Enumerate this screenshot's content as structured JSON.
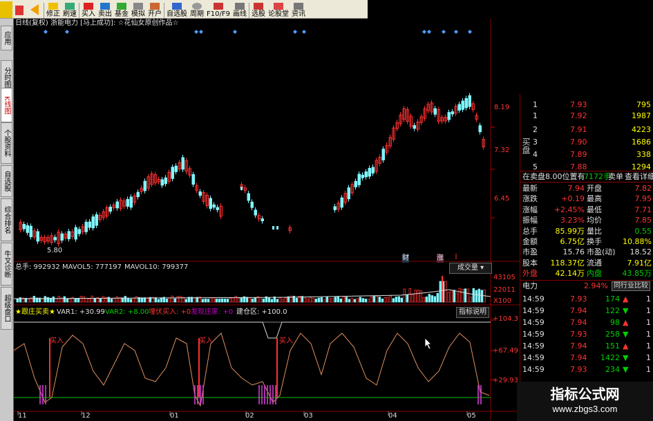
{
  "toolbar": {
    "items": [
      "修正",
      "刷速",
      "买入",
      "卖出",
      "基金",
      "模拟",
      "开户",
      "自选股",
      "周期",
      "F10/F9",
      "画线",
      "选股",
      "论股堂",
      "资讯"
    ]
  },
  "sidetabs": [
    "应用",
    "分时图",
    "K线图",
    "个股资料",
    "自选股",
    "综合排名",
    "牛叉诊断",
    "超级盘口"
  ],
  "chart": {
    "title": "日线(复权)  浙能电力 [马上成功]: ☆花仙女原创作品☆",
    "price_labels": [
      "8.19",
      "7.32",
      "6.45"
    ],
    "low_label": "5.80",
    "marks": [
      "财",
      "涨"
    ],
    "volume_header": {
      "total": "总手: 992932",
      "ma5": "MAVOL5: 777197",
      "ma10": "MAVOL10: 799377"
    },
    "volume_button": "成交量",
    "volume_labels": [
      "43105",
      "22011",
      "X100"
    ],
    "indicator_header": {
      "name": "★跟庄买卖★",
      "var1": "VAR1: +30.99",
      "var2": "VAR2: +8.00",
      "ambush": "埋伏买入: +0",
      "discover": "发现庄家: +0",
      "build": "建仓区: +100.0"
    },
    "indicator_button": "指标说明",
    "indicator_labels": [
      "+104.3",
      "+67.49",
      "+29.93"
    ],
    "buy_label": "买入",
    "x_labels": [
      "11",
      "12",
      "01",
      "02",
      "03",
      "04",
      "05"
    ]
  },
  "orderbook": {
    "side_label": "买盘",
    "rows": [
      {
        "level": "1",
        "price": "7.93",
        "vol": "795"
      },
      {
        "level": "1",
        "price": "7.92",
        "vol": "1987"
      },
      {
        "level": "2",
        "price": "7.91",
        "vol": "4223"
      },
      {
        "level": "3",
        "price": "7.90",
        "vol": "1686"
      },
      {
        "level": "4",
        "price": "7.89",
        "vol": "338"
      },
      {
        "level": "5",
        "price": "7.88",
        "vol": "1294"
      }
    ],
    "status": "在卖盘8.00位置有",
    "status_vol": "7172手",
    "status_sell": "卖单",
    "status_detail": "查看详细"
  },
  "quote": {
    "rows": [
      {
        "l1": "最新",
        "v1": "7.94",
        "l2": "开盘",
        "v2": "7.82"
      },
      {
        "l1": "涨跌",
        "v1": "+0.19",
        "l2": "最高",
        "v2": "7.95"
      },
      {
        "l1": "涨幅",
        "v1": "+2.45%",
        "l2": "最低",
        "v2": "7.71"
      },
      {
        "l1": "振幅",
        "v1": "3.23%",
        "l2": "均价",
        "v2": "7.85"
      },
      {
        "l1": "总手",
        "v1": "85.99万",
        "l2": "量比",
        "v2": "0.55"
      },
      {
        "l1": "金额",
        "v1": "6.75亿",
        "l2": "换手",
        "v2": "10.88%"
      },
      {
        "l1": "市盈",
        "v1": "15.76",
        "l2": "市盈(动)",
        "v2": "18.52"
      },
      {
        "l1": "股本",
        "v1": "118.37亿",
        "l2": "流通",
        "v2": "7.91亿"
      },
      {
        "l1": "外盘",
        "v1": "42.14万",
        "l2": "内盘",
        "v2": "43.85万"
      }
    ],
    "sector": "电力",
    "sector_pct": "2.94%",
    "sector_btn": "同行业比较"
  },
  "ticks": [
    {
      "t": "14:59",
      "p": "7.93",
      "v": "174",
      "d": "up"
    },
    {
      "t": "14:59",
      "p": "7.94",
      "v": "122",
      "d": "down"
    },
    {
      "t": "14:59",
      "p": "7.94",
      "v": "98",
      "d": "up"
    },
    {
      "t": "14:59",
      "p": "7.93",
      "v": "258",
      "d": "down"
    },
    {
      "t": "14:59",
      "p": "7.94",
      "v": "151",
      "d": "up"
    },
    {
      "t": "14:59",
      "p": "7.94",
      "v": "1422",
      "d": "down"
    },
    {
      "t": "14:59",
      "p": "7.93",
      "v": "234",
      "d": "down"
    }
  ],
  "tick_side": [
    "1",
    "1",
    "1",
    "1",
    "1",
    "1",
    "1"
  ],
  "watermark": {
    "line1": "指标公式网",
    "line2": "www.zbgs3.com"
  },
  "colors": {
    "up": "#ff3333",
    "down": "#00ffff",
    "bg": "#000000",
    "green": "#00d000"
  }
}
